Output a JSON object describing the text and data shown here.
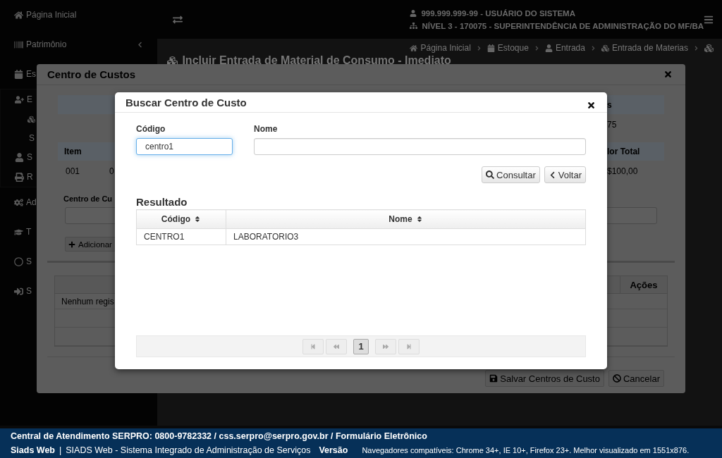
{
  "sidebar": {
    "items": [
      {
        "label": "Página Inicial"
      },
      {
        "label": "Patrimônio",
        "expanded": false
      },
      {
        "label": "Es",
        "children": [
          {
            "label": "E",
            "children": [
              {
                "kind": "icon"
              },
              {
                "kind": "text",
                "label": "S"
              }
            ]
          },
          {
            "label": "S"
          },
          {
            "label": "R"
          }
        ]
      },
      {
        "label": "Ad"
      },
      {
        "label": "T"
      },
      {
        "label": "S"
      },
      {
        "label": "S"
      }
    ]
  },
  "header": {
    "user": "999.999.999-99 - USUÁRIO DO SISTEMA",
    "unit": "NÍVEL 3 - 170075 - SUPERINTENDÊNCIA DE ADMINISTRAÇÃO DO MF/BA"
  },
  "breadcrumb": [
    {
      "label": "Página Inicial"
    },
    {
      "label": "Estoque"
    },
    {
      "label": "Entrada"
    },
    {
      "label": "Entrada de Materias"
    }
  ],
  "page_title": "Incluir Entrada de Material de Consumo - Imediato",
  "cost_center_dialog": {
    "title": "Centro de Custos",
    "section_bar": "s",
    "section_value": "75",
    "items_table": {
      "columns": {
        "left": "Item",
        "right": "lor Total"
      },
      "row": {
        "item": "001",
        "column_2": "0",
        "total": "$100,00"
      }
    },
    "field_label": "Centro de Cu",
    "add_button": "Adicionar",
    "list_table": {
      "columns": [
        "Ações"
      ],
      "empty_text": "Nenhum regis"
    },
    "buttons": [
      {
        "label": "Salvar Centros de Custo",
        "kind": "save"
      },
      {
        "label": "Cancelar",
        "kind": "cancel"
      }
    ]
  },
  "search_dialog": {
    "title": "Buscar Centro de Custo",
    "fields": [
      {
        "label": "Código",
        "value": "centro1",
        "focused": true
      },
      {
        "label": "Nome",
        "focused": false
      }
    ],
    "buttons": [
      {
        "label": "Consultar",
        "kind": "search"
      },
      {
        "label": "Voltar",
        "kind": "back"
      }
    ],
    "result_title": "Resultado",
    "table": {
      "columns": [
        "Código",
        "Nome"
      ],
      "rows": [
        [
          "CENTRO1",
          "LABORATORIO3"
        ]
      ]
    },
    "pager": {
      "nav": [
        {
          "kind": "first",
          "disabled": true
        },
        {
          "kind": "prev",
          "disabled": true
        },
        {
          "kind": "page",
          "label": "1",
          "selected": true
        },
        {
          "kind": "next",
          "disabled": true
        },
        {
          "kind": "last",
          "disabled": true
        }
      ]
    }
  },
  "footer": {
    "contact": "Central de Atendimento SERPRO: 0800-9782332 / css.serpro@serpro.gov.br / Formulário Eletrônico",
    "app_name": "Siads Web",
    "separator": "|",
    "app_full": "SIADS Web - Sistema Integrado de Administração de Serviços",
    "version_label": "Versão",
    "browsers": "Navegadores compatíveis: Chrome 34+, IE 10+, Firefox 23+. Melhor visualizado em 1551x876."
  }
}
